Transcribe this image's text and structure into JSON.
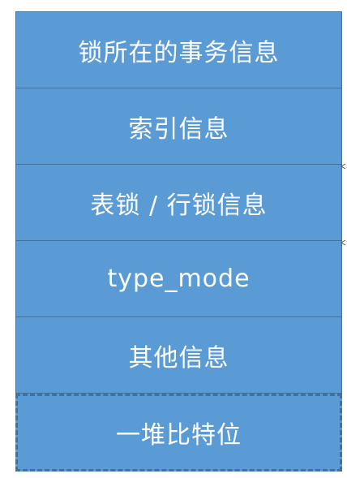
{
  "diagram": {
    "blocks": [
      {
        "label": "锁所在的事务信息"
      },
      {
        "label": "索引信息"
      },
      {
        "label": "表锁 / 行锁信息"
      },
      {
        "label": "type_mode"
      },
      {
        "label": "其他信息"
      },
      {
        "label": "一堆比特位"
      }
    ],
    "colors": {
      "fill": "#5b9bd5",
      "border": "#41719c",
      "text": "#ffffff"
    }
  }
}
